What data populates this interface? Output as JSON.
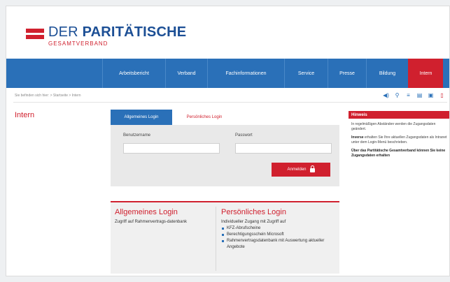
{
  "logo": {
    "line1_plain": "DER ",
    "line1_bold": "PARITÄTISCHE",
    "line2": "GESAMTVERBAND"
  },
  "nav": [
    {
      "label": "Arbeitsbericht"
    },
    {
      "label": "Verband"
    },
    {
      "label": "Fachinformationen"
    },
    {
      "label": "Service"
    },
    {
      "label": "Presse"
    },
    {
      "label": "Bildung"
    },
    {
      "label": "Intern"
    }
  ],
  "breadcrumb": "Sie befinden sich hier:  > Startseite > Intern",
  "sidebar_title": "Intern",
  "tabs": {
    "general": "Allgemeines Login",
    "personal": "Persönliches Login"
  },
  "login": {
    "username_label": "Benutzername",
    "password_label": "Passwort",
    "submit_label": "Anmelden"
  },
  "panels": {
    "general_title": "Allgemeines Login",
    "general_text": "Zugriff auf Rahmenvertrags-datenbank",
    "personal_title": "Persönliches Login",
    "personal_intro": "Individueller Zugang mit Zugriff auf",
    "personal_items": [
      "KFZ-Abrufscheine",
      "Berechtigungsschein Microsoft",
      "Rahmenvertragsdatenbank mit Auswertung aktueller Angebote"
    ]
  },
  "hint": {
    "title": "Hinweis",
    "p1": "In regelmäßigen Abständen werden die Zugangsdaten geändert.",
    "p2_bold": "Inverse",
    "p2": " erhalten Sie Ihre aktuellen Zugangsdaten als Intranet unter dem Login-Menü beschrieben.",
    "p3_bold": "Über das Partitätische Gesamtverband können Sie keine Zugangsdaten erhalten"
  },
  "tools": [
    "speaker-icon",
    "search-icon",
    "print-icon",
    "page-icon",
    "save-icon",
    "font-icon"
  ],
  "colors": {
    "brand_blue": "#2a70b8",
    "brand_red": "#d0202e"
  }
}
